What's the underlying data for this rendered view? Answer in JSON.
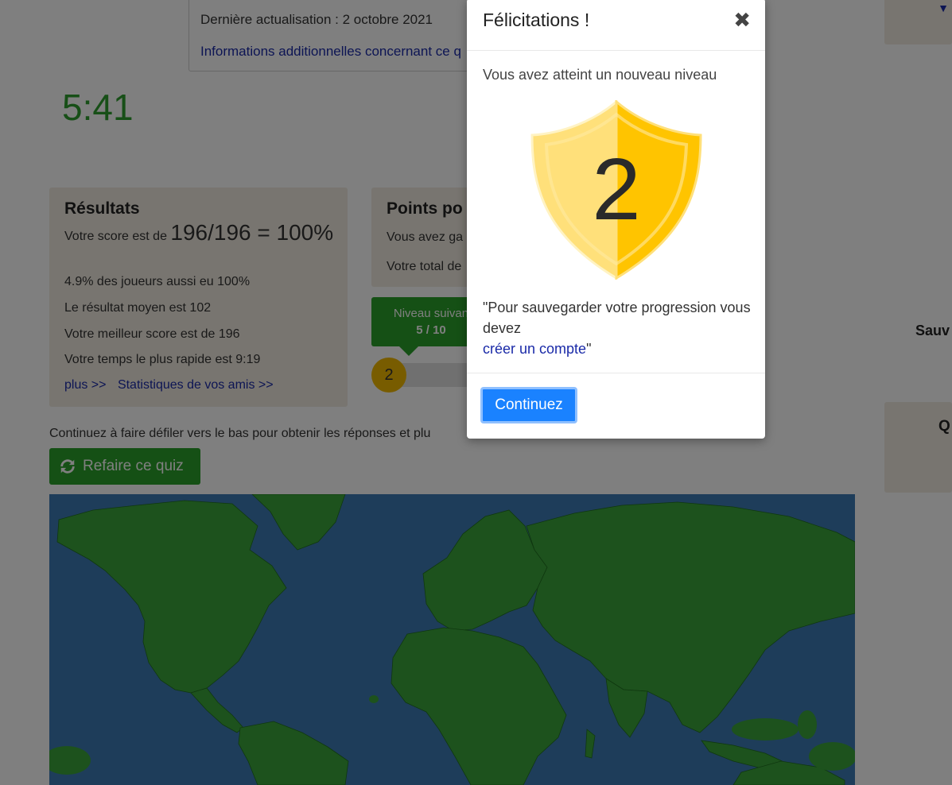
{
  "info": {
    "updated": "Dernière actualisation : 2 octobre 2021",
    "more_info_link": "Informations additionnelles concernant ce q"
  },
  "timer": "5:41",
  "results": {
    "title": "Résultats",
    "score_prefix": "Votre score est de ",
    "score_value": "196/196 = 100%",
    "pct_players": "4.9% des joueurs aussi eu 100%",
    "avg_result": "Le résultat moyen est 102",
    "best_score": "Votre meilleur score est de 196",
    "fastest_time": "Votre temps le plus rapide est 9:19",
    "more_link": "plus >>",
    "friends_link": "Statistiques de vos amis >>"
  },
  "points": {
    "title": "Points po",
    "gained": "Vous avez ga",
    "total": "Votre total de"
  },
  "next_level": {
    "label": "Niveau suivan",
    "progress_text": "5 / 10",
    "progress_fraction": 0.5,
    "current_level": "2"
  },
  "scroll_hint": "Continuez à faire défiler vers le bas pour obtenir les réponses et plu",
  "redo_button": "Refaire ce quiz",
  "side": {
    "save_text": "Sauv",
    "q_text": "Q"
  },
  "modal": {
    "title": "Félicitations !",
    "close_symbol": "✖",
    "reached_text": "Vous avez atteint un nouveau niveau",
    "badge_level": "2",
    "save_note_prefix": "\"Pour sauvegarder votre progression vous devez",
    "create_account_link": "créer un compte",
    "save_note_suffix": "\"",
    "continue_button": "Continuez"
  },
  "colors": {
    "green_button": "#2aa02a",
    "primary_button": "#1a82ff",
    "link_blue": "#1a2aa8",
    "ocean": "#3d7ab4",
    "land": "#3aa43a",
    "shield_light": "#ffe07a",
    "shield_dark": "#ffc400"
  }
}
